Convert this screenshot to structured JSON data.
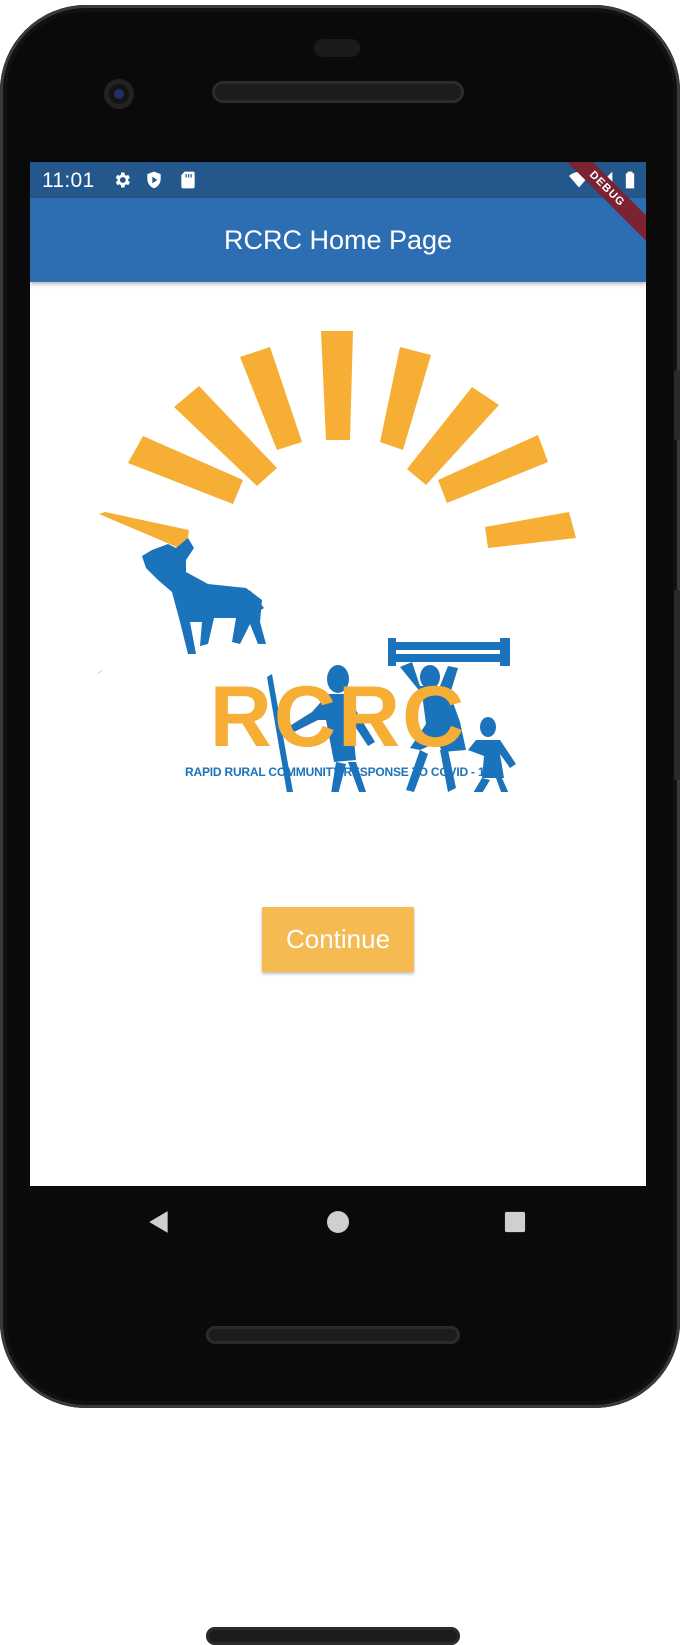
{
  "status_bar": {
    "time": "11:01",
    "left_icons": [
      "settings-icon",
      "shield-icon",
      "sd-card-icon"
    ],
    "right_icons": [
      "wifi-icon",
      "cell-signal-icon",
      "battery-icon"
    ]
  },
  "app_bar": {
    "title": "RCRC Home Page"
  },
  "debug_banner": "DEBUG",
  "logo": {
    "title": "RCRC",
    "subtitle": "RAPID RURAL COMMUNITY RESPONSE TO COVID - 19",
    "colors": {
      "sun": "#f6ae35",
      "figures": "#1b73bb"
    }
  },
  "continue_button": {
    "label": "Continue",
    "color": "#f5bb52"
  },
  "nav_bar": {
    "items": [
      "back-icon",
      "home-icon",
      "recents-icon"
    ]
  }
}
